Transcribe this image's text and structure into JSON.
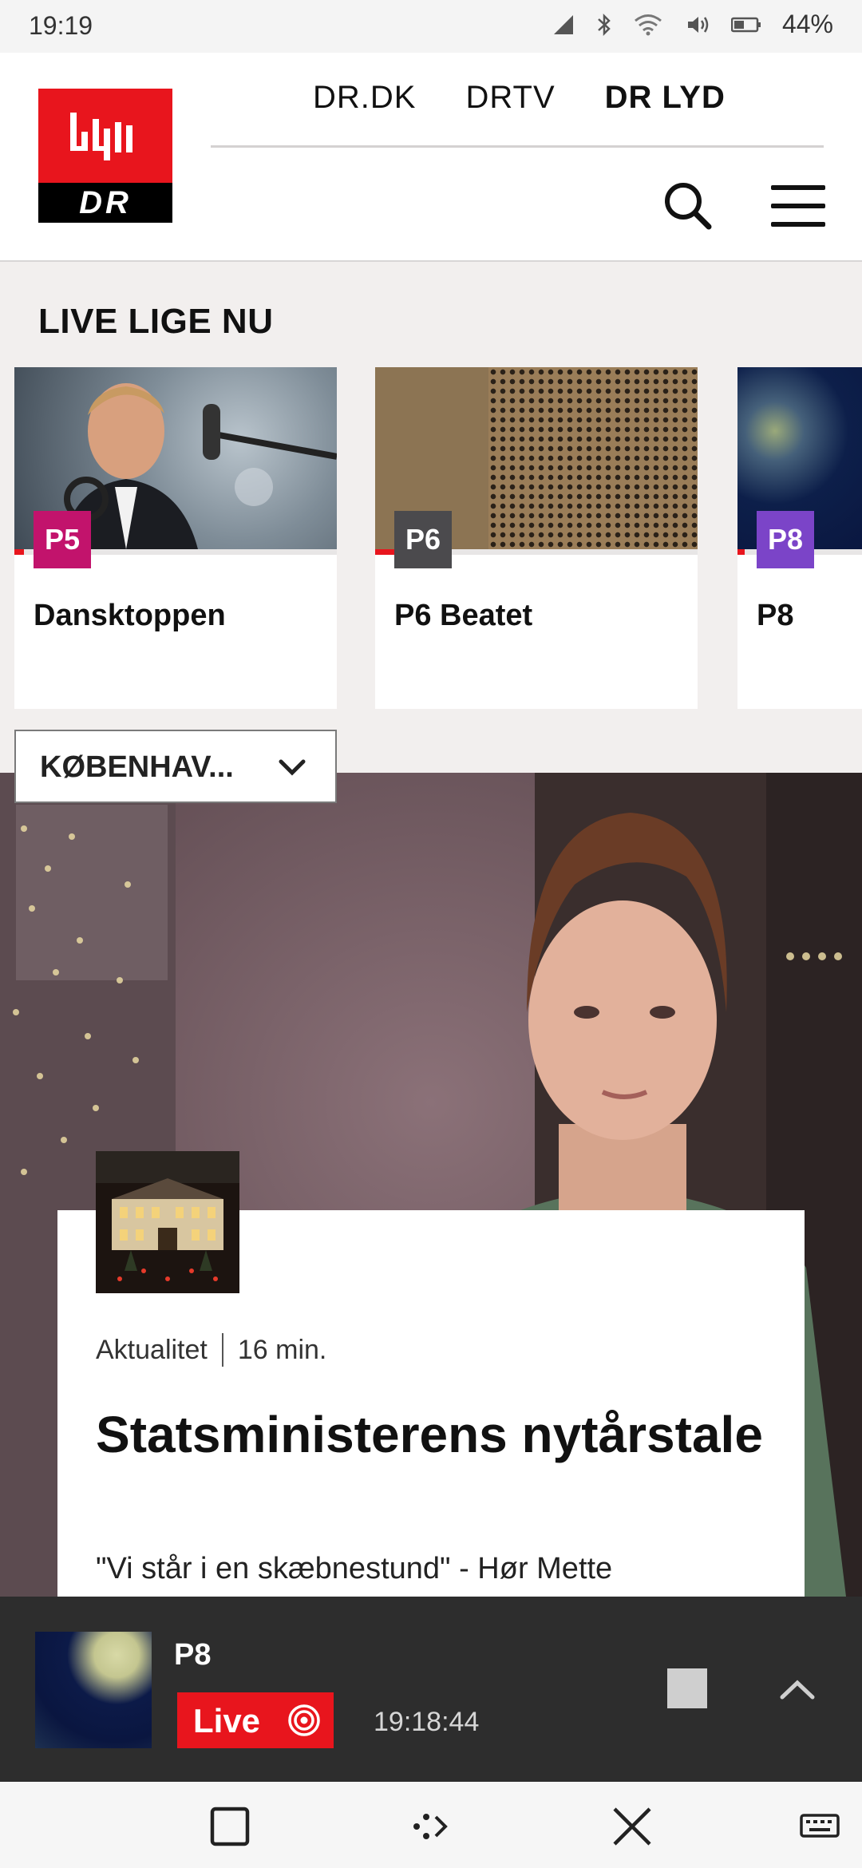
{
  "status_bar": {
    "time": "19:19",
    "battery": "44%",
    "icons": [
      "signal-icon",
      "bluetooth-icon",
      "wifi-icon",
      "vibrate-icon",
      "battery-icon"
    ]
  },
  "header": {
    "logo_text": "DR",
    "nav": [
      {
        "label": "DR.DK",
        "active": false
      },
      {
        "label": "DRTV",
        "active": false
      },
      {
        "label": "DR LYD",
        "active": true
      }
    ]
  },
  "live": {
    "title": "LIVE LIGE NU",
    "cards": [
      {
        "channel": "P5",
        "title": "Dansktoppen",
        "badge_color": "#c2136c",
        "progress": 0.03
      },
      {
        "channel": "P6",
        "title": "P6 Beatet",
        "badge_color": "#4b4a4d",
        "progress": 0.06
      },
      {
        "channel": "P8",
        "title": "P8",
        "badge_color": "#7b44c8",
        "progress": 0.06
      }
    ]
  },
  "region": {
    "label": "KØBENHAV..."
  },
  "article": {
    "category": "Aktualitet",
    "duration": "16 min.",
    "title": "Statsministerens nytårstale",
    "subtitle": "\"Vi står i en skæbnestund\" - Hør Mette"
  },
  "player": {
    "channel": "P8",
    "live_label": "Live",
    "time": "19:18:44"
  },
  "colors": {
    "accent": "#e8151d",
    "player_bg": "#2d2d2d",
    "page_bg": "#f2efee"
  }
}
